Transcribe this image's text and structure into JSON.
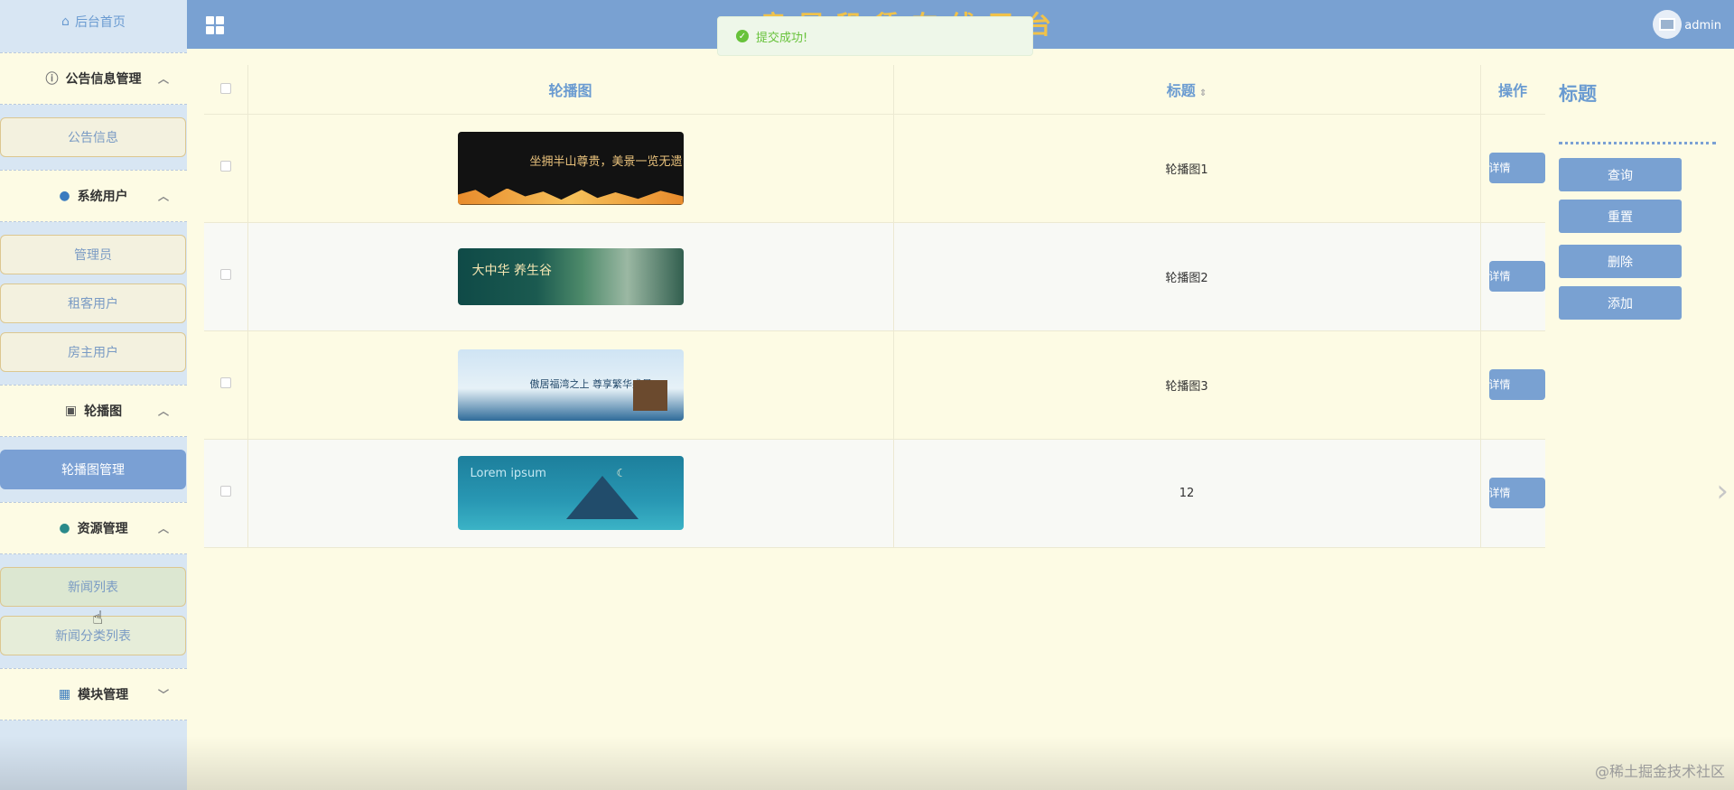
{
  "topbar": {
    "site_title": "房屋租赁在线平台",
    "toast": "提交成功!",
    "username": "admin"
  },
  "sidebar": {
    "home": "后台首页",
    "groups": [
      {
        "label": "公告信息管理",
        "items": [
          "公告信息"
        ]
      },
      {
        "label": "系统用户",
        "items": [
          "管理员",
          "租客用户",
          "房主用户"
        ]
      },
      {
        "label": "轮播图",
        "items": [
          "轮播图管理"
        ]
      },
      {
        "label": "资源管理",
        "items": [
          "新闻列表",
          "新闻分类列表"
        ]
      },
      {
        "label": "模块管理",
        "items": []
      }
    ]
  },
  "table": {
    "headers": {
      "image": "轮播图",
      "title": "标题",
      "action": "操作"
    },
    "rows": [
      {
        "title": "轮播图1",
        "banner_text": "坐拥半山尊贵，美景一览无遗",
        "button": "详情"
      },
      {
        "title": "轮播图2",
        "banner_text": "大中华 养生谷",
        "button": "详情"
      },
      {
        "title": "轮播图3",
        "banner_text": "傲居福湾之上 尊享繁华盛景",
        "button": "详情"
      },
      {
        "title": "12",
        "banner_text": "Lorem ipsum",
        "button": "详情"
      }
    ]
  },
  "right_panel": {
    "title": "标题",
    "buttons": {
      "query": "查询",
      "reset": "重置",
      "delete": "删除",
      "add": "添加"
    }
  },
  "watermark": "@稀土掘金技术社区",
  "colors": {
    "primary": "#79a1d2",
    "background": "#fdfbe4",
    "sidebar": "#d8e6f3",
    "title_gold": "#f0c24a",
    "success": "#67c23a"
  }
}
